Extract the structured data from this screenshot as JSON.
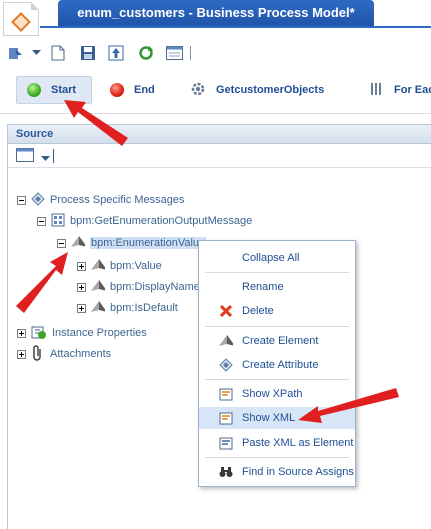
{
  "window": {
    "title": "enum_customers - Business Process Model*"
  },
  "palette": {
    "items": [
      {
        "label": "Start",
        "icon": "green-circle-icon",
        "color": "#33aa22"
      },
      {
        "label": "End",
        "icon": "red-circle-icon",
        "color": "#dd2211"
      },
      {
        "label": "GetcustomerObjects",
        "icon": "gear-icon"
      },
      {
        "label": "For Eac",
        "icon": "for-each-icon"
      }
    ]
  },
  "source_panel": {
    "title": "Source",
    "tree": {
      "messages": "Process Specific Messages",
      "output_message": "bpm:GetEnumerationOutputMessage",
      "enum_value": "bpm:EnumerationValue",
      "value": "bpm:Value",
      "display_name": "bpm:DisplayName",
      "is_default": "bpm:IsDefault",
      "instance_props": "Instance Properties",
      "attachments": "Attachments"
    }
  },
  "context_menu": {
    "items": {
      "collapse_all": "Collapse All",
      "rename": "Rename",
      "delete": "Delete",
      "create_element": "Create Element",
      "create_attribute": "Create Attribute",
      "show_xpath": "Show XPath",
      "show_xml": "Show XML",
      "paste_xml": "Paste XML as Element",
      "find_in_source": "Find in Source Assigns"
    },
    "selected": "Show XML"
  },
  "colors": {
    "accent": "#2f6bc4",
    "arrow": "#e02020",
    "selection": "#d7e6f7"
  }
}
